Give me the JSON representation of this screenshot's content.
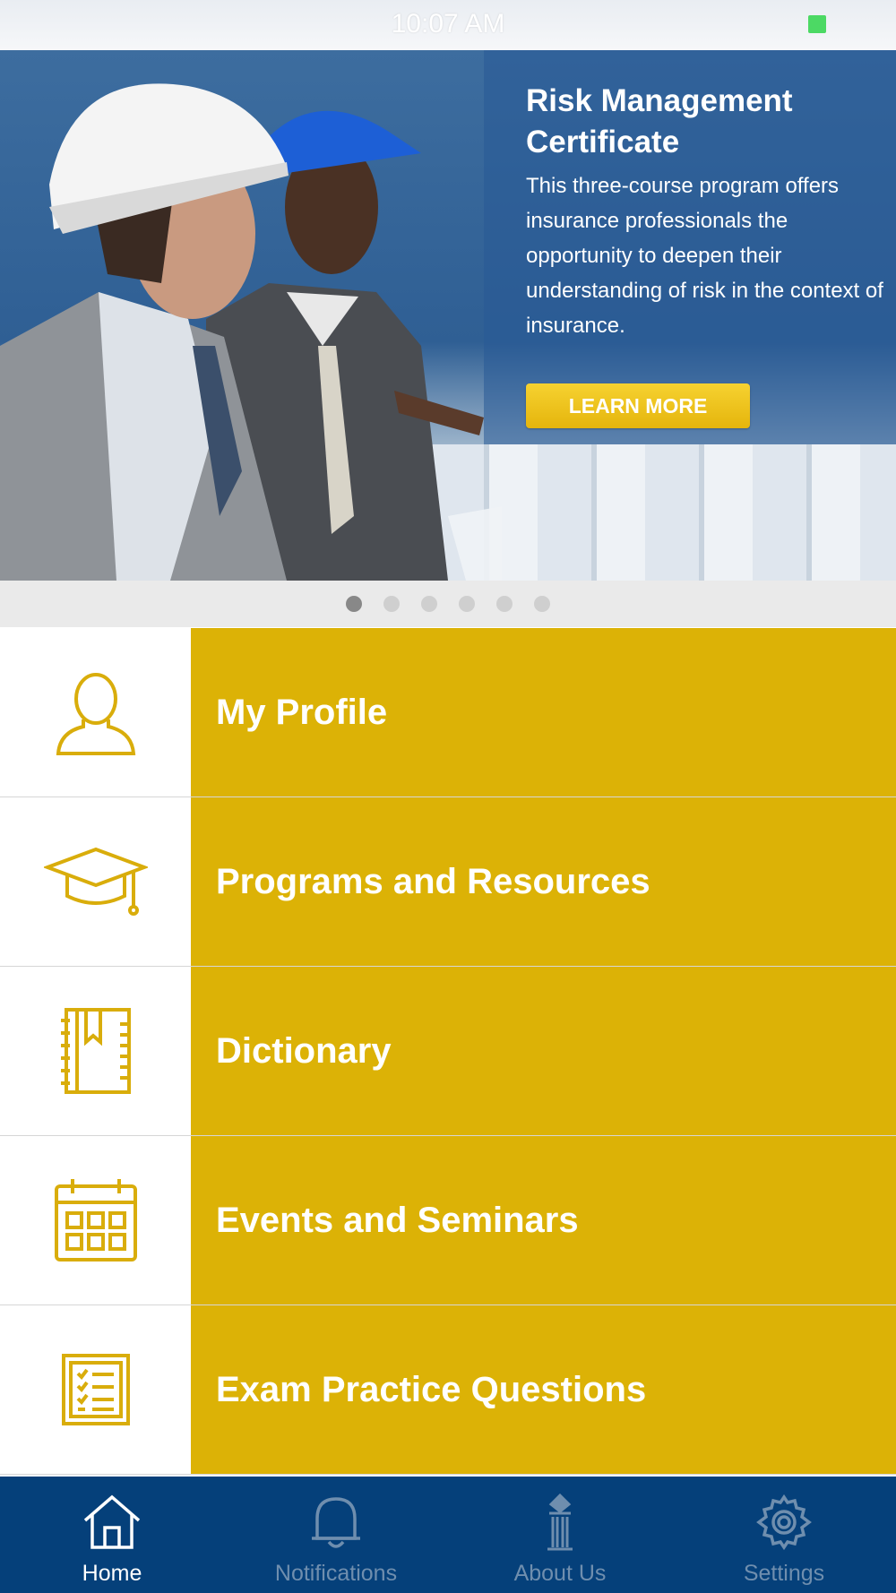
{
  "status_bar": {
    "time": "10:07 AM"
  },
  "banner": {
    "title": "Risk Management Certificate",
    "description": "This three-course program offers insurance professionals the opportunity to deepen their understanding of risk in the context of insurance.",
    "button_label": "LEARN MORE",
    "page_count": 6,
    "active_page": 1
  },
  "menu": {
    "items": [
      {
        "label": "My Profile",
        "icon": "user-icon"
      },
      {
        "label": "Programs and Resources",
        "icon": "graduation-cap-icon"
      },
      {
        "label": "Dictionary",
        "icon": "book-icon"
      },
      {
        "label": "Events and Seminars",
        "icon": "calendar-icon"
      },
      {
        "label": "Exam Practice Questions",
        "icon": "checklist-icon"
      }
    ]
  },
  "tab_bar": {
    "tabs": [
      {
        "label": "Home",
        "icon": "home-icon",
        "active": true
      },
      {
        "label": "Notifications",
        "icon": "bell-icon",
        "active": false
      },
      {
        "label": "About Us",
        "icon": "column-icon",
        "active": false
      },
      {
        "label": "Settings",
        "icon": "gear-icon",
        "active": false
      }
    ]
  },
  "colors": {
    "menu_gold": "#dcb206",
    "tab_bar_blue": "#05407a",
    "icon_gold": "#d9ad0b",
    "button_yellow": "#f1c61c"
  }
}
